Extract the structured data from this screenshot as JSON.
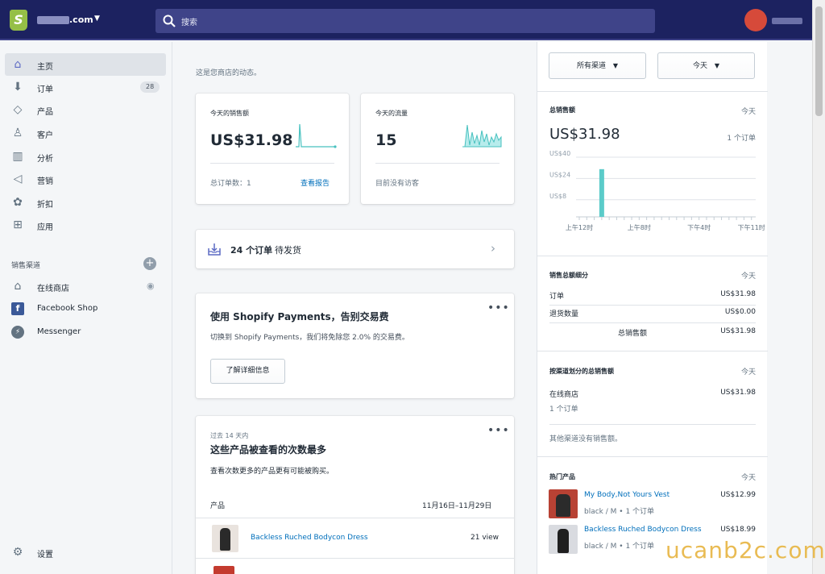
{
  "topbar": {
    "store_name": ".com",
    "search_placeholder": "搜索"
  },
  "sidebar": {
    "items": [
      {
        "label": "主页",
        "icon": "home-icon"
      },
      {
        "label": "订单",
        "icon": "orders-icon",
        "badge": "28"
      },
      {
        "label": "产品",
        "icon": "tag-icon"
      },
      {
        "label": "客户",
        "icon": "person-icon"
      },
      {
        "label": "分析",
        "icon": "bar-chart-icon"
      },
      {
        "label": "营销",
        "icon": "megaphone-icon"
      },
      {
        "label": "折扣",
        "icon": "discount-icon"
      },
      {
        "label": "应用",
        "icon": "apps-icon"
      }
    ],
    "channels_title": "销售渠道",
    "channels": [
      {
        "label": "在线商店",
        "icon": "store-icon"
      },
      {
        "label": "Facebook Shop",
        "icon": "facebook-icon"
      },
      {
        "label": "Messenger",
        "icon": "messenger-icon"
      }
    ],
    "settings_label": "设置"
  },
  "main": {
    "intro": "这是您商店的动态。",
    "sales_card": {
      "title": "今天的销售额",
      "value": "US$31.98",
      "orders_label": "总订单数：1",
      "report_link": "查看报告"
    },
    "traffic_card": {
      "title": "今天的流量",
      "value": "15",
      "no_visitors": "目前没有访客"
    },
    "orders_banner": {
      "count": "24 个订单",
      "suffix": "待发货"
    },
    "payments_card": {
      "title": "使用 Shopify Payments，告别交易费",
      "body": "切换到 Shopify Payments，我们将免除您 2.0% 的交易费。",
      "button": "了解详细信息"
    },
    "views_card": {
      "period": "过去 14 天内",
      "title": "这些产品被查看的次数最多",
      "body": "查看次数更多的产品更有可能被购买。",
      "col_product": "产品",
      "col_date": "11月16日–11月29日",
      "rows": [
        {
          "name": "Backless Ruched Bodycon Dress",
          "views": "21 view"
        }
      ]
    }
  },
  "right": {
    "filter_channel": "所有渠道",
    "filter_date": "今天",
    "total_sales": {
      "title": "总销售额",
      "date": "今天",
      "value": "US$31.98",
      "orders": "1 个订单"
    },
    "chart_data": {
      "type": "bar",
      "x": [
        "上午12时",
        "上午8时",
        "下午4时",
        "下午11时"
      ],
      "yticks": [
        "US$40",
        "US$24",
        "US$8"
      ],
      "values": [
        0,
        0,
        0,
        31.98,
        0,
        0,
        0,
        0,
        0,
        0,
        0,
        0,
        0,
        0,
        0,
        0,
        0,
        0,
        0,
        0,
        0,
        0,
        0,
        0
      ],
      "ylim": [
        0,
        40
      ]
    },
    "breakdown": {
      "title": "销售总额细分",
      "date": "今天",
      "rows": [
        {
          "label": "订单",
          "value": "US$31.98"
        },
        {
          "label": "退货数量",
          "value": "US$0.00"
        },
        {
          "label": "总销售额",
          "value": "US$31.98"
        }
      ]
    },
    "by_channel": {
      "title": "按渠道划分的总销售额",
      "date": "今天",
      "channel": "在线商店",
      "orders": "1 个订单",
      "value": "US$31.98",
      "note": "其他渠道没有销售额。"
    },
    "top_products": {
      "title": "热门产品",
      "date": "今天",
      "items": [
        {
          "name": "My Body,Not Yours Vest",
          "variant": "black / M • 1 个订单",
          "price": "US$12.99"
        },
        {
          "name": "Backless Ruched Bodycon Dress",
          "variant": "black / M • 1 个订单",
          "price": "US$18.99"
        }
      ]
    }
  },
  "watermark": "ucanb2c.com"
}
